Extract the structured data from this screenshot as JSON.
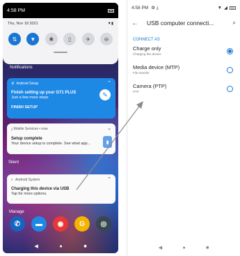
{
  "left": {
    "status": {
      "time": "4:58 PM",
      "battery": "battery"
    },
    "quick_settings": {
      "date": "Thu, Nov 18 2021",
      "tiles": [
        {
          "name": "data-tile",
          "glyph": "⇅",
          "on": true
        },
        {
          "name": "wifi-tile",
          "glyph": "▼",
          "on": true
        },
        {
          "name": "bluetooth-tile",
          "glyph": "✱",
          "on": false
        },
        {
          "name": "flashlight-tile",
          "glyph": "▯",
          "on": false
        },
        {
          "name": "airplane-tile",
          "glyph": "✈",
          "on": false
        },
        {
          "name": "dnd-tile",
          "glyph": "⊖",
          "on": false
        }
      ]
    },
    "notifications_label": "Notifications",
    "setup_card": {
      "app": "Android Setup",
      "title": "Finish setting up your G71 PLUS",
      "subtitle": "Just a few more steps",
      "action": "FINISH SETUP"
    },
    "mobile_card": {
      "app": "Mobile Services • now",
      "title": "Setup complete",
      "subtitle": "Your device setup is complete. See what app..."
    },
    "silent_label": "Silent",
    "system_card": {
      "app": "Android System",
      "title": "Charging this device via USB",
      "subtitle": "Tap for more options."
    },
    "manage_label": "Manage",
    "dock": [
      {
        "name": "phone-app-icon",
        "glyph": "✆",
        "color": "#1565c0"
      },
      {
        "name": "messages-app-icon",
        "glyph": "▬",
        "color": "#1e88e5"
      },
      {
        "name": "chrome-app-icon",
        "glyph": "◉",
        "color": "#e53935"
      },
      {
        "name": "google-app-icon",
        "glyph": "G",
        "color": "#f4b400"
      },
      {
        "name": "camera-app-icon",
        "glyph": "◎",
        "color": "#37474f"
      }
    ],
    "nav": {
      "back": "◀",
      "home": "●",
      "recents": "■"
    }
  },
  "right": {
    "status": {
      "time": "4:58 PM",
      "extra": "⚙ ⤓",
      "battery": "battery"
    },
    "title": "USB computer connecti...",
    "section": "CONNECT AS",
    "options": [
      {
        "title": "Charge only",
        "subtitle": "Charging this device",
        "selected": true
      },
      {
        "title": "Media device (MTP)",
        "subtitle": "File transfer",
        "selected": false
      },
      {
        "title": "Camera (PTP)",
        "subtitle": "PTP",
        "selected": false
      }
    ],
    "nav": {
      "back": "◀",
      "home": "●",
      "recents": "■"
    }
  },
  "colors": {
    "accent": "#1976d2",
    "setup_card": "#1e88e5"
  }
}
